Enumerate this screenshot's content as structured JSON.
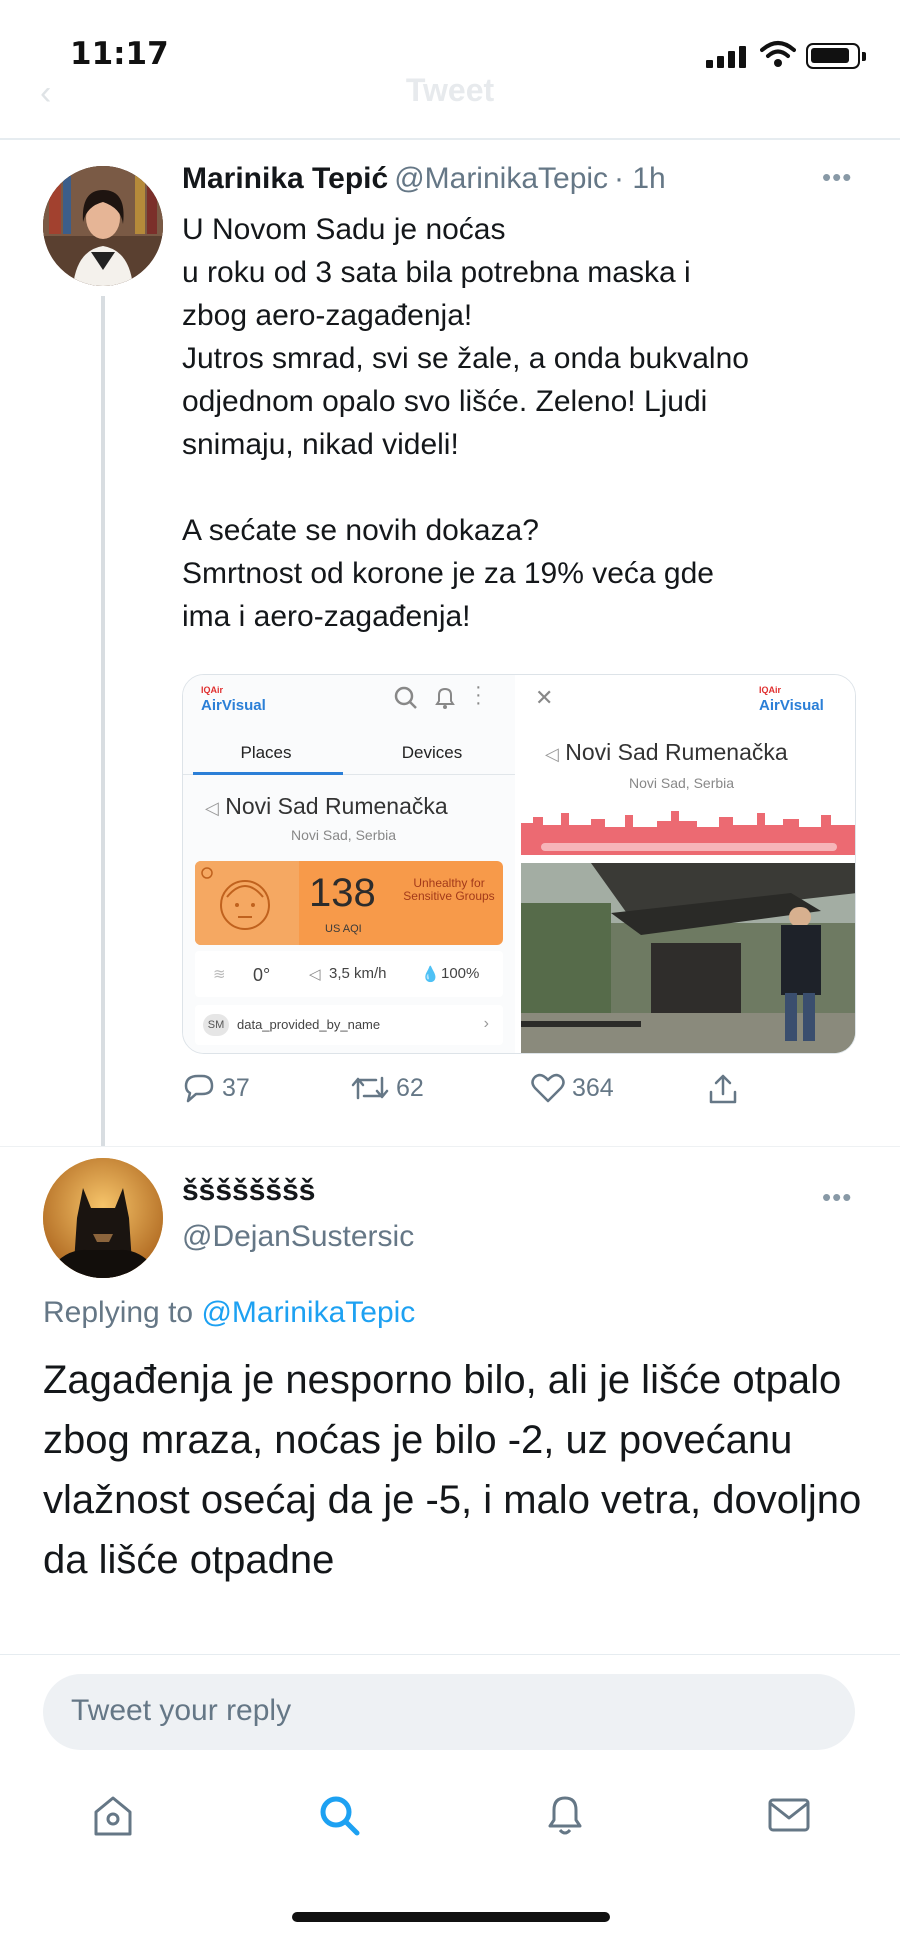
{
  "status_bar": {
    "time": "11:17"
  },
  "nav": {
    "title": "Tweet",
    "back_icon": "back-arrow-icon"
  },
  "tweet": {
    "author_name": "Marinika Tepić",
    "author_handle": "@MarinikaTepic",
    "age": "· 1h",
    "text": "U Novom Sadu je noćas\nu roku od 3 sata bila potrebna maska i\nzbog aero-zagađenja!\nJutros smrad, svi se žale, a onda bukvalno\nodjednom opalo svo lišće. Zeleno! Ljudi\nsnimaju, nikad videli!\n\nA sećate se novih dokaza?\nSmrtnost od korone je za 19% veća gde\nima i aero-zagađenja!",
    "media": {
      "left": {
        "brand_small": "IQAir",
        "brand": "AirVisual",
        "tab_places": "Places",
        "tab_devices": "Devices",
        "place_name": "Novi Sad Rumenačka",
        "place_sub": "Novi Sad, Serbia",
        "aqi_value": "138",
        "aqi_unit": "US AQI",
        "aqi_status": "Unhealthy for Sensitive Groups",
        "temperature": "0°",
        "wind": "3,5 km/h",
        "humidity": "100%",
        "provider_badge": "SM",
        "provider": "data_provided_by_name"
      },
      "right": {
        "brand_small": "IQAir",
        "brand": "AirVisual",
        "place_name": "Novi Sad Rumenačka",
        "place_sub": "Novi Sad, Serbia"
      }
    },
    "replies": "37",
    "retweets": "62",
    "likes": "364"
  },
  "reply_tweet": {
    "author_name": "šššššššš",
    "author_handle": "@DejanSustersic",
    "replying_prefix": "Replying to ",
    "replying_to": "@MarinikaTepic",
    "text": "Zagađenja je nesporno bilo, ali je lišće otpalo zbog mraza, noćas je bilo -2, uz povećanu vlažnost osećaj da je -5, i malo vetra, dovoljno da lišće otpadne"
  },
  "reply_bar": {
    "placeholder": "Tweet your reply"
  },
  "tabbar": {
    "items": [
      "home-icon",
      "search-icon",
      "notifications-icon",
      "messages-icon"
    ],
    "active": "search-icon"
  },
  "colors": {
    "link": "#1da1f2",
    "secondary_text": "#657786",
    "aqi_orange": "#f79a4a"
  }
}
